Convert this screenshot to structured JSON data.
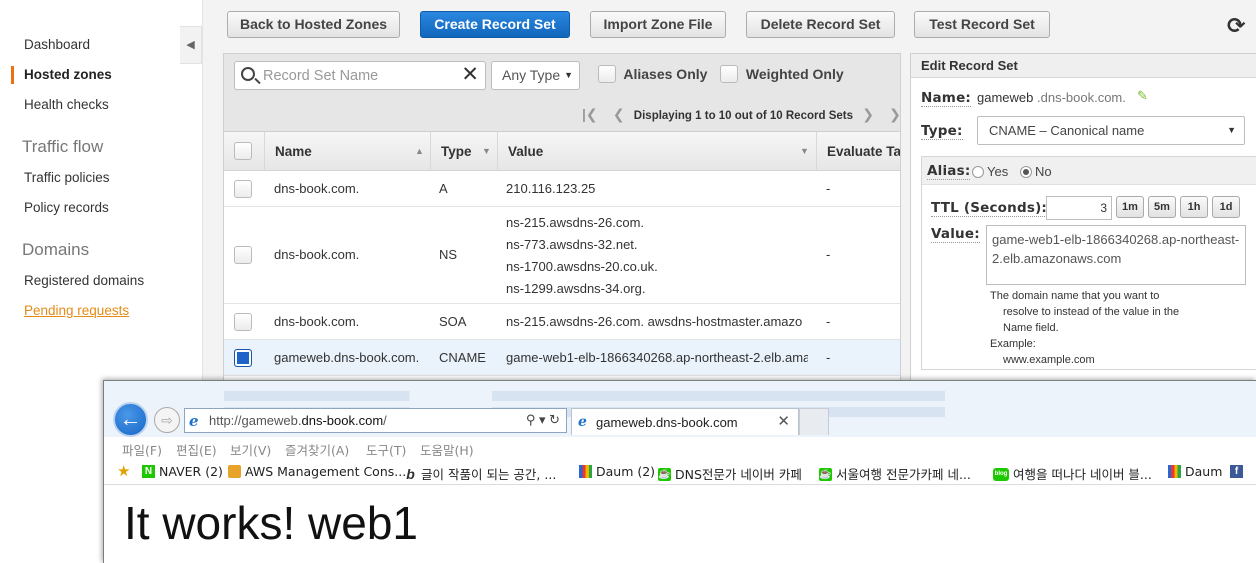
{
  "sidebar": {
    "items": [
      "Dashboard",
      "Hosted zones",
      "Health checks"
    ],
    "traffic_flow_heading": "Traffic flow",
    "traffic_items": [
      "Traffic policies",
      "Policy records"
    ],
    "domains_heading": "Domains",
    "domain_items": [
      "Registered domains",
      "Pending requests"
    ],
    "active_item": "Hosted zones",
    "collapse_icon": "◀",
    "accent_color": "#ec7211"
  },
  "toolbar": {
    "back": "Back to Hosted Zones",
    "create": "Create Record Set",
    "import": "Import Zone File",
    "delete": "Delete Record Set",
    "test": "Test Record Set",
    "refresh_icon": "⟳",
    "primary_color": "#1166bb"
  },
  "filters": {
    "search_placeholder": "Record Set Name",
    "type_select": "Any Type",
    "aliases_only": "Aliases Only",
    "weighted_only": "Weighted Only",
    "pager_text": "Displaying 1 to 10 out of 10 Record Sets",
    "pager_first_icon": "|❮",
    "pager_prev_icon": "❮",
    "pager_next_icon": "❯",
    "pager_last_icon": "❯|"
  },
  "table": {
    "columns": [
      "Name",
      "Type",
      "Value",
      "Evaluate Tar"
    ],
    "rows": [
      {
        "name": "dns-book.com.",
        "type": "A",
        "values": [
          "210.116.123.25"
        ],
        "evaluate": "-",
        "selected": false
      },
      {
        "name": "dns-book.com.",
        "type": "NS",
        "values": [
          "ns-215.awsdns-26.com.",
          "ns-773.awsdns-32.net.",
          "ns-1700.awsdns-20.co.uk.",
          "ns-1299.awsdns-34.org."
        ],
        "evaluate": "-",
        "selected": false
      },
      {
        "name": "dns-book.com.",
        "type": "SOA",
        "values": [
          "ns-215.awsdns-26.com. awsdns-hostmaster.amazo"
        ],
        "evaluate": "-",
        "selected": false
      },
      {
        "name": "gameweb.dns-book.com.",
        "type": "CNAME",
        "values": [
          "game-web1-elb-1866340268.ap-northeast-2.elb.ama:"
        ],
        "evaluate": "-",
        "selected": true
      }
    ]
  },
  "edit": {
    "title": "Edit Record Set",
    "name_label": "Name:",
    "name_value": "gameweb",
    "name_domain": ".dns-book.com.",
    "type_label": "Type:",
    "type_value": "CNAME – Canonical name",
    "alias_label": "Alias:",
    "alias_yes": "Yes",
    "alias_no": "No",
    "alias_selected": "No",
    "ttl_label": "TTL (Seconds):",
    "ttl_value": "3",
    "ttl_presets": [
      "1m",
      "5m",
      "1h",
      "1d"
    ],
    "value_label": "Value:",
    "value_text": "game-web1-elb-1866340268.ap-northeast-2.elb.amazonaws.com",
    "help_lines": [
      "The domain name that you want to",
      "resolve to instead of the value in the",
      "Name field.",
      "Example:",
      "www.example.com"
    ]
  },
  "browser": {
    "back_icon": "←",
    "forward_icon": "⇨",
    "url_prefix": "http://gameweb.",
    "url_host": "dns-book.com",
    "url_suffix": "/",
    "addr_tools": "⚲ ▾ ↻",
    "tab_title": "gameweb.dns-book.com",
    "tab_close": "✕",
    "ie_logo": "e",
    "menu": [
      "파일(F)",
      "편집(E)",
      "보기(V)",
      "즐겨찾기(A)",
      "도구(T)",
      "도움말(H)"
    ],
    "favorites": [
      "NAVER (2)",
      "AWS Management Cons...",
      "글이 작품이 되는 공간, ...",
      "Daum (2)",
      "DNS전문가  네이버 카페",
      "서울여행 전문가카페  네...",
      "여행을 떠나다  네이버 블...",
      "Daum"
    ],
    "fav_star": "★",
    "page_heading": "It works! web1"
  }
}
